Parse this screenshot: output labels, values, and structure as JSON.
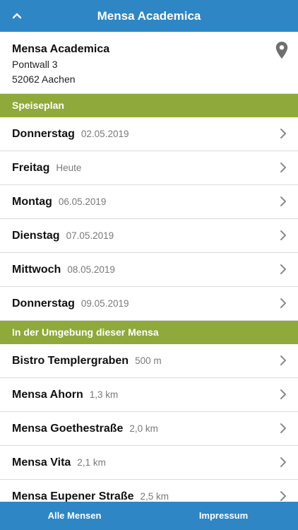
{
  "navbar": {
    "title": "Mensa Academica",
    "back_icon": "chevron-up-icon"
  },
  "address": {
    "name": "Mensa Academica",
    "street": "Pontwall 3",
    "city": "52062 Aachen",
    "pin_icon": "location-pin-icon"
  },
  "speiseplan": {
    "header": "Speiseplan",
    "days": [
      {
        "day": "Donnerstag",
        "date": "02.05.2019"
      },
      {
        "day": "Freitag",
        "date": "Heute"
      },
      {
        "day": "Montag",
        "date": "06.05.2019"
      },
      {
        "day": "Dienstag",
        "date": "07.05.2019"
      },
      {
        "day": "Mittwoch",
        "date": "08.05.2019"
      },
      {
        "day": "Donnerstag",
        "date": "09.05.2019"
      }
    ]
  },
  "nearby": {
    "header": "In der Umgebung dieser Mensa",
    "places": [
      {
        "name": "Bistro Templergraben",
        "distance": "500 m"
      },
      {
        "name": "Mensa Ahorn",
        "distance": "1,3 km"
      },
      {
        "name": "Mensa Goethestraße",
        "distance": "2,0 km"
      },
      {
        "name": "Mensa Vita",
        "distance": "2,1 km"
      },
      {
        "name": "Mensa Eupener Straße",
        "distance": "2,5 km"
      }
    ]
  },
  "tabbar": {
    "left": "Alle Mensen",
    "right": "Impressum"
  },
  "colors": {
    "primary_blue": "#2f86c4",
    "section_green": "#8fa93a"
  }
}
